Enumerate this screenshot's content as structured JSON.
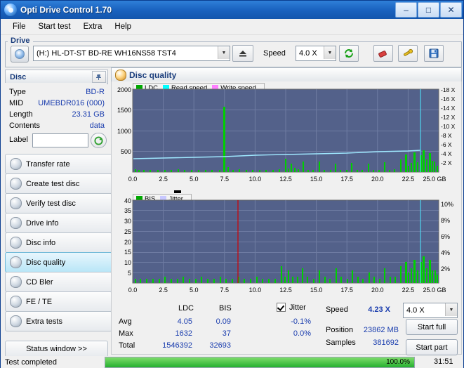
{
  "window": {
    "title": "Opti Drive Control 1.70",
    "minimize": "–",
    "maximize": "□",
    "close": "✕"
  },
  "menu": [
    "File",
    "Start test",
    "Extra",
    "Help"
  ],
  "drive": {
    "group_label": "Drive",
    "selected": "(H:)  HL-DT-ST BD-RE  WH16NS58 TST4",
    "eject_icon": "eject-icon",
    "speed_label": "Speed",
    "speed_value": "4.0 X",
    "refresh_icon": "refresh-icon",
    "erase_icon": "eraser-icon",
    "tools_icon": "tools-icon",
    "save_icon": "save-icon"
  },
  "disc": {
    "header": "Disc",
    "pin_icon": "pin-icon",
    "rows": [
      {
        "label": "Type",
        "value": "BD-R"
      },
      {
        "label": "MID",
        "value": "UMEBDR016 (000)"
      },
      {
        "label": "Length",
        "value": "23.31 GB"
      },
      {
        "label": "Contents",
        "value": "data"
      },
      {
        "label": "Label",
        "value": ""
      }
    ],
    "label_button_icon": "disc-refresh-icon"
  },
  "sidebar": {
    "items": [
      {
        "label": "Transfer rate",
        "active": false
      },
      {
        "label": "Create test disc",
        "active": false
      },
      {
        "label": "Verify test disc",
        "active": false
      },
      {
        "label": "Drive info",
        "active": false
      },
      {
        "label": "Disc info",
        "active": false
      },
      {
        "label": "Disc quality",
        "active": true
      },
      {
        "label": "CD Bler",
        "active": false
      },
      {
        "label": "FE / TE",
        "active": false
      },
      {
        "label": "Extra tests",
        "active": false
      }
    ],
    "status_window": "Status window >>"
  },
  "quality": {
    "header": "Disc quality",
    "top_legend": [
      {
        "name": "LDC",
        "color": "#00a800"
      },
      {
        "name": "Read speed",
        "color": "#00ffff"
      },
      {
        "name": "Write speed",
        "color": "#ff80ff"
      }
    ],
    "bottom_legend": [
      {
        "name": "BIS",
        "color": "#00a800"
      },
      {
        "name": "Jitter",
        "color": "#c8c8ff"
      }
    ],
    "stats": {
      "col_headers": [
        "LDC",
        "BIS"
      ],
      "rows": [
        {
          "label": "Avg",
          "ldc": "4.05",
          "bis": "0.09"
        },
        {
          "label": "Max",
          "ldc": "1632",
          "bis": "37"
        },
        {
          "label": "Total",
          "ldc": "1546392",
          "bis": "32693"
        }
      ],
      "jitter_label": "Jitter",
      "jitter_checked": true,
      "jitter_avg": "-0.1%",
      "jitter_max": "0.0%",
      "speed_label": "Speed",
      "speed_value": "4.23 X",
      "speed_combo": "4.0 X",
      "position_label": "Position",
      "position_value": "23862 MB",
      "samples_label": "Samples",
      "samples_value": "381692",
      "start_full": "Start full",
      "start_part": "Start part"
    }
  },
  "chart_data": [
    {
      "type": "line",
      "title": "LDC / Read speed",
      "xlabel": "GB",
      "ylabel": "LDC",
      "xlim": [
        0,
        25
      ],
      "xticks": [
        "0.0",
        "2.5",
        "5.0",
        "7.5",
        "10.0",
        "12.5",
        "15.0",
        "17.5",
        "20.0",
        "22.5",
        "25.0 GB"
      ],
      "ylim": [
        0,
        2000
      ],
      "yticks": [
        "500",
        "1000",
        "1500",
        "2000"
      ],
      "y2ticks": [
        "-2 X",
        "-4 X",
        "-6 X",
        "-8 X",
        "-10 X",
        "-12 X",
        "-14 X",
        "-16 X",
        "-18 X"
      ],
      "series": [
        {
          "name": "LDC",
          "color": "#00d000",
          "type": "bar",
          "x": [
            0.2,
            0.5,
            0.9,
            1.4,
            2.0,
            2.6,
            3.1,
            3.7,
            4.2,
            4.8,
            5.3,
            5.9,
            6.4,
            7.0,
            7.4,
            7.5,
            7.9,
            8.4,
            9.0,
            9.5,
            10.1,
            10.6,
            11.2,
            11.7,
            12.2,
            12.4,
            12.6,
            12.9,
            13.2,
            13.6,
            14.0,
            14.4,
            14.9,
            15.3,
            15.8,
            16.2,
            16.6,
            17.1,
            17.5,
            18.0,
            18.4,
            18.9,
            19.3,
            19.8,
            20.2,
            20.7,
            21.1,
            21.6,
            22.0,
            22.2,
            22.4,
            22.6,
            22.8,
            23.0,
            23.2,
            23.4,
            23.6,
            23.8,
            24.0,
            24.2
          ],
          "y": [
            60,
            40,
            45,
            40,
            50,
            45,
            40,
            55,
            45,
            40,
            50,
            45,
            40,
            50,
            1580,
            120,
            45,
            60,
            50,
            45,
            55,
            50,
            45,
            60,
            330,
            90,
            200,
            110,
            70,
            260,
            60,
            50,
            250,
            60,
            45,
            200,
            55,
            50,
            230,
            60,
            45,
            210,
            60,
            50,
            240,
            55,
            60,
            300,
            420,
            160,
            220,
            480,
            240,
            400,
            520,
            300,
            460,
            280,
            260,
            160
          ]
        },
        {
          "name": "Read speed",
          "color": "#9fe8ff",
          "type": "line",
          "x": [
            0,
            2.5,
            5,
            7.5,
            10,
            12.5,
            15,
            17.5,
            20,
            22.5,
            23.5
          ],
          "y": [
            330,
            350,
            365,
            380,
            400,
            415,
            430,
            450,
            465,
            485,
            495
          ]
        }
      ]
    },
    {
      "type": "line",
      "title": "BIS / Jitter",
      "xlabel": "GB",
      "ylabel": "BIS",
      "xlim": [
        0,
        25
      ],
      "xticks": [
        "0.0",
        "2.5",
        "5.0",
        "7.5",
        "10.0",
        "12.5",
        "15.0",
        "17.5",
        "20.0",
        "22.5",
        "25.0 GB"
      ],
      "ylim": [
        0,
        40
      ],
      "yticks": [
        "5",
        "10",
        "15",
        "20",
        "25",
        "30",
        "35",
        "40"
      ],
      "y2ticks": [
        "2%",
        "4%",
        "6%",
        "8%",
        "10%"
      ],
      "series": [
        {
          "name": "BIS",
          "color": "#00d000",
          "type": "bar",
          "x": [
            0.2,
            0.6,
            1.1,
            1.6,
            2.1,
            2.6,
            3.1,
            3.6,
            4.1,
            4.6,
            5.1,
            5.6,
            6.1,
            6.6,
            7.1,
            7.6,
            8.1,
            8.6,
            9.1,
            9.6,
            10.1,
            10.6,
            11.1,
            11.6,
            12.1,
            12.4,
            12.6,
            12.9,
            13.3,
            13.7,
            14.1,
            14.6,
            15.0,
            15.5,
            15.9,
            16.4,
            16.8,
            17.3,
            17.7,
            18.2,
            18.6,
            19.1,
            19.5,
            20.0,
            20.4,
            20.9,
            21.3,
            21.8,
            22.0,
            22.2,
            22.4,
            22.6,
            22.8,
            23.0,
            23.2,
            23.4,
            23.6,
            23.8,
            24.0,
            24.2
          ],
          "y": [
            2,
            2,
            2,
            2,
            2,
            3,
            2,
            2,
            3,
            2,
            2,
            3,
            2,
            2,
            3,
            2,
            2,
            3,
            2,
            2,
            3,
            2,
            2,
            2,
            8,
            3,
            6,
            3,
            3,
            7,
            3,
            2,
            6,
            3,
            2,
            7,
            3,
            2,
            6,
            3,
            2,
            5,
            3,
            2,
            7,
            3,
            3,
            8,
            10,
            5,
            7,
            11,
            6,
            10,
            13,
            7,
            11,
            6,
            6,
            4
          ]
        },
        {
          "name": "Jitter",
          "color": "#c8c8ff",
          "type": "line",
          "x": [],
          "y": []
        }
      ],
      "markers": [
        {
          "name": "red-cursor",
          "x": 8.6,
          "color": "#d00000"
        }
      ]
    }
  ],
  "statusbar": {
    "text": "Test completed",
    "progress_pct": "100.0%",
    "time": "31:51"
  }
}
